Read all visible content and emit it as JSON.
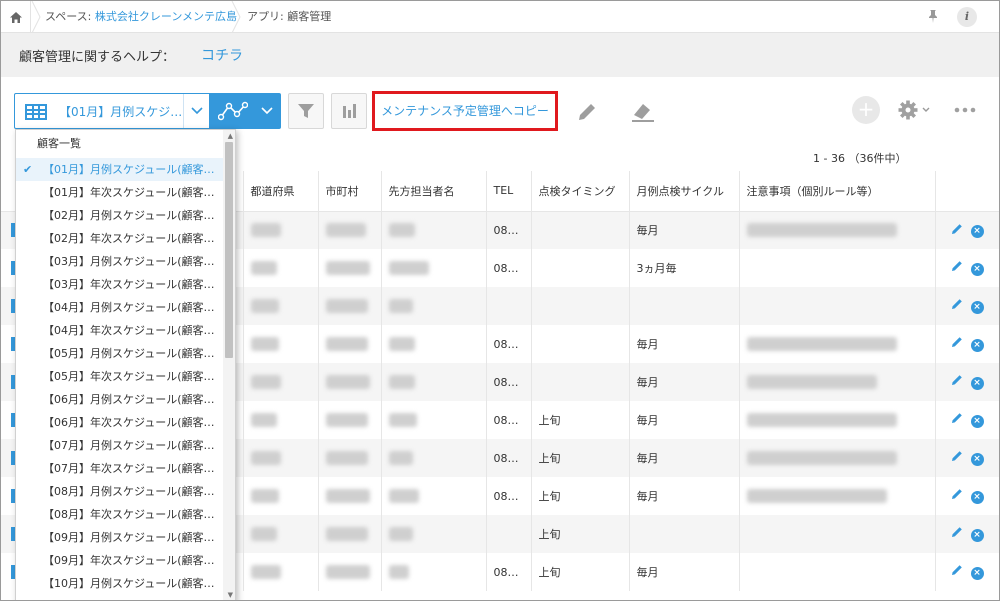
{
  "breadcrumb": {
    "space_label": "スペース: ",
    "space_name": "株式会社クレーンメンテ広島",
    "app_label": "アプリ: 顧客管理"
  },
  "help": {
    "label": "顧客管理に関するヘルプ：",
    "link": "コチラ"
  },
  "toolbar": {
    "view_name": "【01月】月例スケジ…",
    "copy_button": "メンテナンス予定管理へコピー"
  },
  "pager": "1 - 36 （36件中）",
  "table": {
    "columns": [
      "都道府県",
      "市町村",
      "先方担当者名",
      "TEL",
      "点検タイミング",
      "月例点検サイクル",
      "注意事項（個別ルール等）"
    ],
    "rows": [
      {
        "tel": "08…",
        "timing": "",
        "cycle": "毎月"
      },
      {
        "tel": "08…",
        "timing": "",
        "cycle": "3ヵ月毎"
      },
      {
        "tel": "",
        "timing": "",
        "cycle": ""
      },
      {
        "tel": "08…",
        "timing": "",
        "cycle": "毎月"
      },
      {
        "tel": "08…",
        "timing": "",
        "cycle": "毎月"
      },
      {
        "tel": "08…",
        "timing": "上旬",
        "cycle": "毎月"
      },
      {
        "tel": "08…",
        "timing": "上旬",
        "cycle": "毎月"
      },
      {
        "tel": "08…",
        "timing": "上旬",
        "cycle": "毎月"
      },
      {
        "tel": "",
        "timing": "上旬",
        "cycle": ""
      },
      {
        "tel": "08…",
        "timing": "上旬",
        "cycle": "毎月"
      }
    ]
  },
  "dropdown": {
    "header": "顧客一覧",
    "items": [
      "【01月】月例スケジュール(顧客…",
      "【01月】年次スケジュール(顧客…",
      "【02月】月例スケジュール(顧客…",
      "【02月】年次スケジュール(顧客…",
      "【03月】月例スケジュール(顧客…",
      "【03月】年次スケジュール(顧客…",
      "【04月】月例スケジュール(顧客…",
      "【04月】年次スケジュール(顧客…",
      "【05月】月例スケジュール(顧客…",
      "【05月】年次スケジュール(顧客…",
      "【06月】月例スケジュール(顧客…",
      "【06月】年次スケジュール(顧客…",
      "【07月】月例スケジュール(顧客…",
      "【07月】年次スケジュール(顧客…",
      "【08月】月例スケジュール(顧客…",
      "【08月】年次スケジュール(顧客…",
      "【09月】月例スケジュール(顧客…",
      "【09月】年次スケジュール(顧客…",
      "【10月】月例スケジュール(顧客…"
    ]
  }
}
